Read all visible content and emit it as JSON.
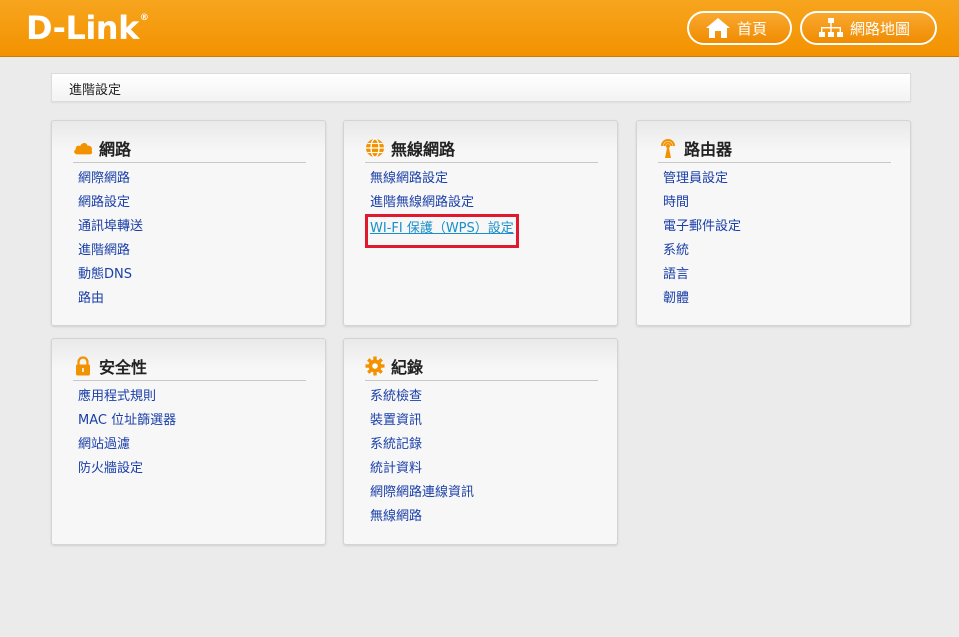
{
  "header": {
    "logo": "D-Link",
    "logo_mark": "®",
    "home_label": "首頁",
    "map_label": "網路地圖"
  },
  "breadcrumb": "進階設定",
  "panels": {
    "network": {
      "title": "網路",
      "icon": "cloud-icon",
      "items": [
        "網際網路",
        "網路設定",
        "通訊埠轉送",
        "進階網路",
        "動態DNS",
        "路由"
      ]
    },
    "wireless": {
      "title": "無線網路",
      "icon": "globe-icon",
      "items": [
        "無線網路設定",
        "進階無線網路設定",
        "WI-FI 保護（WPS）設定"
      ]
    },
    "router": {
      "title": "路由器",
      "icon": "antenna-icon",
      "items": [
        "管理員設定",
        "時間",
        "電子郵件設定",
        "系統",
        "語言",
        "韌體"
      ]
    },
    "security": {
      "title": "安全性",
      "icon": "lock-icon",
      "items": [
        "應用程式規則",
        "MAC 位址篩選器",
        "網站過濾",
        "防火牆設定"
      ]
    },
    "logs": {
      "title": "紀錄",
      "icon": "gear-icon",
      "items": [
        "系統檢查",
        "裝置資訊",
        "系統記錄",
        "統計資料",
        "網際網路連線資訊",
        "無線網路"
      ]
    }
  },
  "colors": {
    "header_orange": "#f39200",
    "link_blue": "#1a3fa8",
    "highlight_red": "#e0192f"
  }
}
